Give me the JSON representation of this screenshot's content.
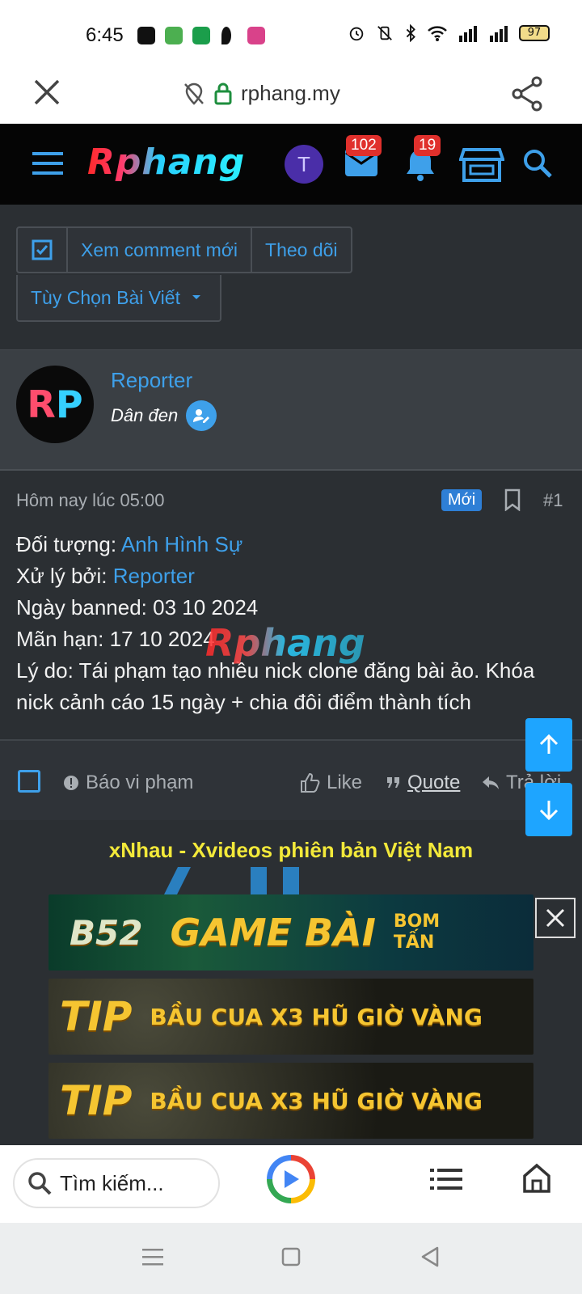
{
  "status_bar": {
    "time": "6:45",
    "battery": "97"
  },
  "browser": {
    "url": "rphang.my"
  },
  "site": {
    "logo": "Rphang",
    "user_initial": "T",
    "messages_count": "102",
    "alerts_count": "19"
  },
  "thread_controls": {
    "view_new": "Xem comment mới",
    "follow": "Theo dõi",
    "options": "Tùy Chọn Bài Viết"
  },
  "post": {
    "avatar_text_r": "R",
    "avatar_text_p": "P",
    "username": "Reporter",
    "user_title": "Dân đen",
    "time": "Hôm nay lúc 05:00",
    "new_badge": "Mới",
    "number": "#1",
    "line1_label": "Đối tượng: ",
    "line1_value": "Anh Hình Sự",
    "line2_label": "Xử lý bởi: ",
    "line2_value": "Reporter",
    "line3": "Ngày banned: 03 10 2024",
    "line4": "Mãn hạn: 17 10 2024",
    "line5": "Lý do: Tái phạm tạo nhiều nick clone đăng bài ảo. Khóa nick cảnh cáo 15 ngày + chia đôi điểm thành tích",
    "watermark": "Rphang"
  },
  "post_actions": {
    "report": "Báo vi phạm",
    "like": "Like",
    "quote": "Quote",
    "reply": "Trả lời"
  },
  "promo": {
    "title": "xNhau - Xvideos phiên bản Việt Nam",
    "banner1_brand": "B52",
    "banner1_text": "GAME BÀI",
    "banner1_sub1": "BOM",
    "banner1_sub2": "TẤN",
    "banner2_brand": "TIP",
    "banner2_text": "BẦU CUA X3 HŨ GIỜ VÀNG",
    "banner3_brand": "TIP",
    "banner3_text": "BẦU CUA X3 HŨ GIỜ VÀNG"
  },
  "bottom_bar": {
    "search_placeholder": "Tìm kiếm..."
  },
  "colors": {
    "accent": "#3ea0ea",
    "header_bg": "#050505",
    "body_bg": "#2b2f33",
    "badge": "#e0302c",
    "promo_title": "#f3e93a"
  }
}
